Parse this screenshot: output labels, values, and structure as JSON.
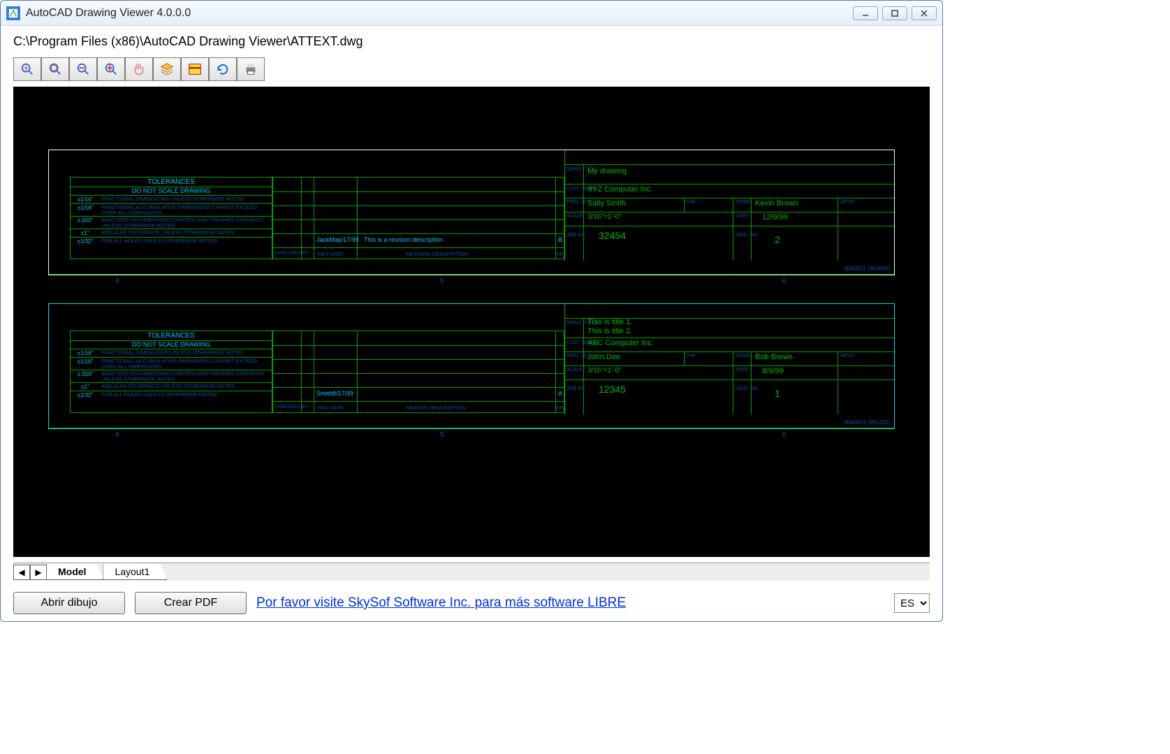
{
  "window": {
    "title": "AutoCAD Drawing Viewer 4.0.0.0"
  },
  "file_path": "C:\\Program Files (x86)\\AutoCAD Drawing Viewer\\ATTEXT.dwg",
  "toolbar_icons": [
    "zoom-extents",
    "zoom-window",
    "zoom-out",
    "zoom-in",
    "pan",
    "layers",
    "layout",
    "refresh",
    "print"
  ],
  "tabs": {
    "nav_prev": "◀",
    "nav_next": "▶",
    "items": [
      {
        "label": "Model",
        "active": true
      },
      {
        "label": "Layout1",
        "active": false
      }
    ]
  },
  "buttons": {
    "open": "Abrir dibujo",
    "pdf": "Crear PDF"
  },
  "link_text": "Por favor visite SkySof Software Inc. para más software LIBRE",
  "lang": "ES",
  "tolerances": {
    "heading": "TOLERANCES",
    "sub": "DO NOT SCALE DRAWING",
    "rows": [
      {
        "lead": "±1/16\"",
        "desc": "FRACTIONAL DIMENSIONS UNLESS OTHERWISE NOTED"
      },
      {
        "lead": "±1/16\"",
        "desc": "FRACTIONAL ACCUMULATIVE DIMENSIONS CANNOT EXCEED OVER-ALL DIMENSIONS"
      },
      {
        "lead": "±.010\"",
        "desc": "ANALYZED ON DIMENSION CONTROLLING FINISHED SURFACES UNLESS OTHERWISE NOTED"
      },
      {
        "lead": "±1°",
        "desc": "ANGULAR TOLERANCE UNLESS OTHERWISE NOTED"
      },
      {
        "lead": "±1/32\"",
        "desc": "FOR ALL HOLES UNLESS OTHERWISE NOTED"
      }
    ]
  },
  "rev_labels": {
    "checked_by": "CHECKED BY:",
    "rev_date": "REV DATE",
    "rev_desc": "REVISION DESCRIPTION",
    "rev": "REV.",
    "reason_desc": "REASON DESCRIPTION"
  },
  "titleblock1": {
    "title": "My drawing.",
    "company": "XYZ Computer Inc.",
    "drawn_by": "Sally Smith",
    "checked_by": "Kevin Brown",
    "scale": "3/16\"=1'-0\"",
    "date": "12/9/99",
    "job_no": "32454",
    "dwg_no": "2",
    "rev_author": "JackMay/17/99",
    "rev_text": "This is a revision description.",
    "rev": "B",
    "footer": "0040031 (962630)"
  },
  "titleblock2": {
    "title1": "This is title 1.",
    "title2": "This is title 2.",
    "company": "ABC Computer Inc.",
    "drawn_by": "John Doe",
    "checked_by": "Bob Brown",
    "scale": "3/16\"=1'-0\"",
    "date": "8/9/99",
    "job_no": "12345",
    "dwg_no": "1",
    "rev_author": "Smith8/17/99",
    "rev_text": "",
    "rev": "A",
    "footer": "0040031 (961292)"
  },
  "tb_labels": {
    "drwg_title": "DRWG. TITLE:",
    "cust_name": "CUST. NAME:",
    "prel": "PREL. BY:",
    "chk": "CHK:",
    "drwn": "DRWN:",
    "apvd": "APVD:",
    "scale": "SCALE:",
    "date": "DATE:",
    "job_no": "JOB NO.",
    "dwg_no": "DWG. NO."
  },
  "ruler_nums": [
    "4",
    "5",
    "6"
  ]
}
